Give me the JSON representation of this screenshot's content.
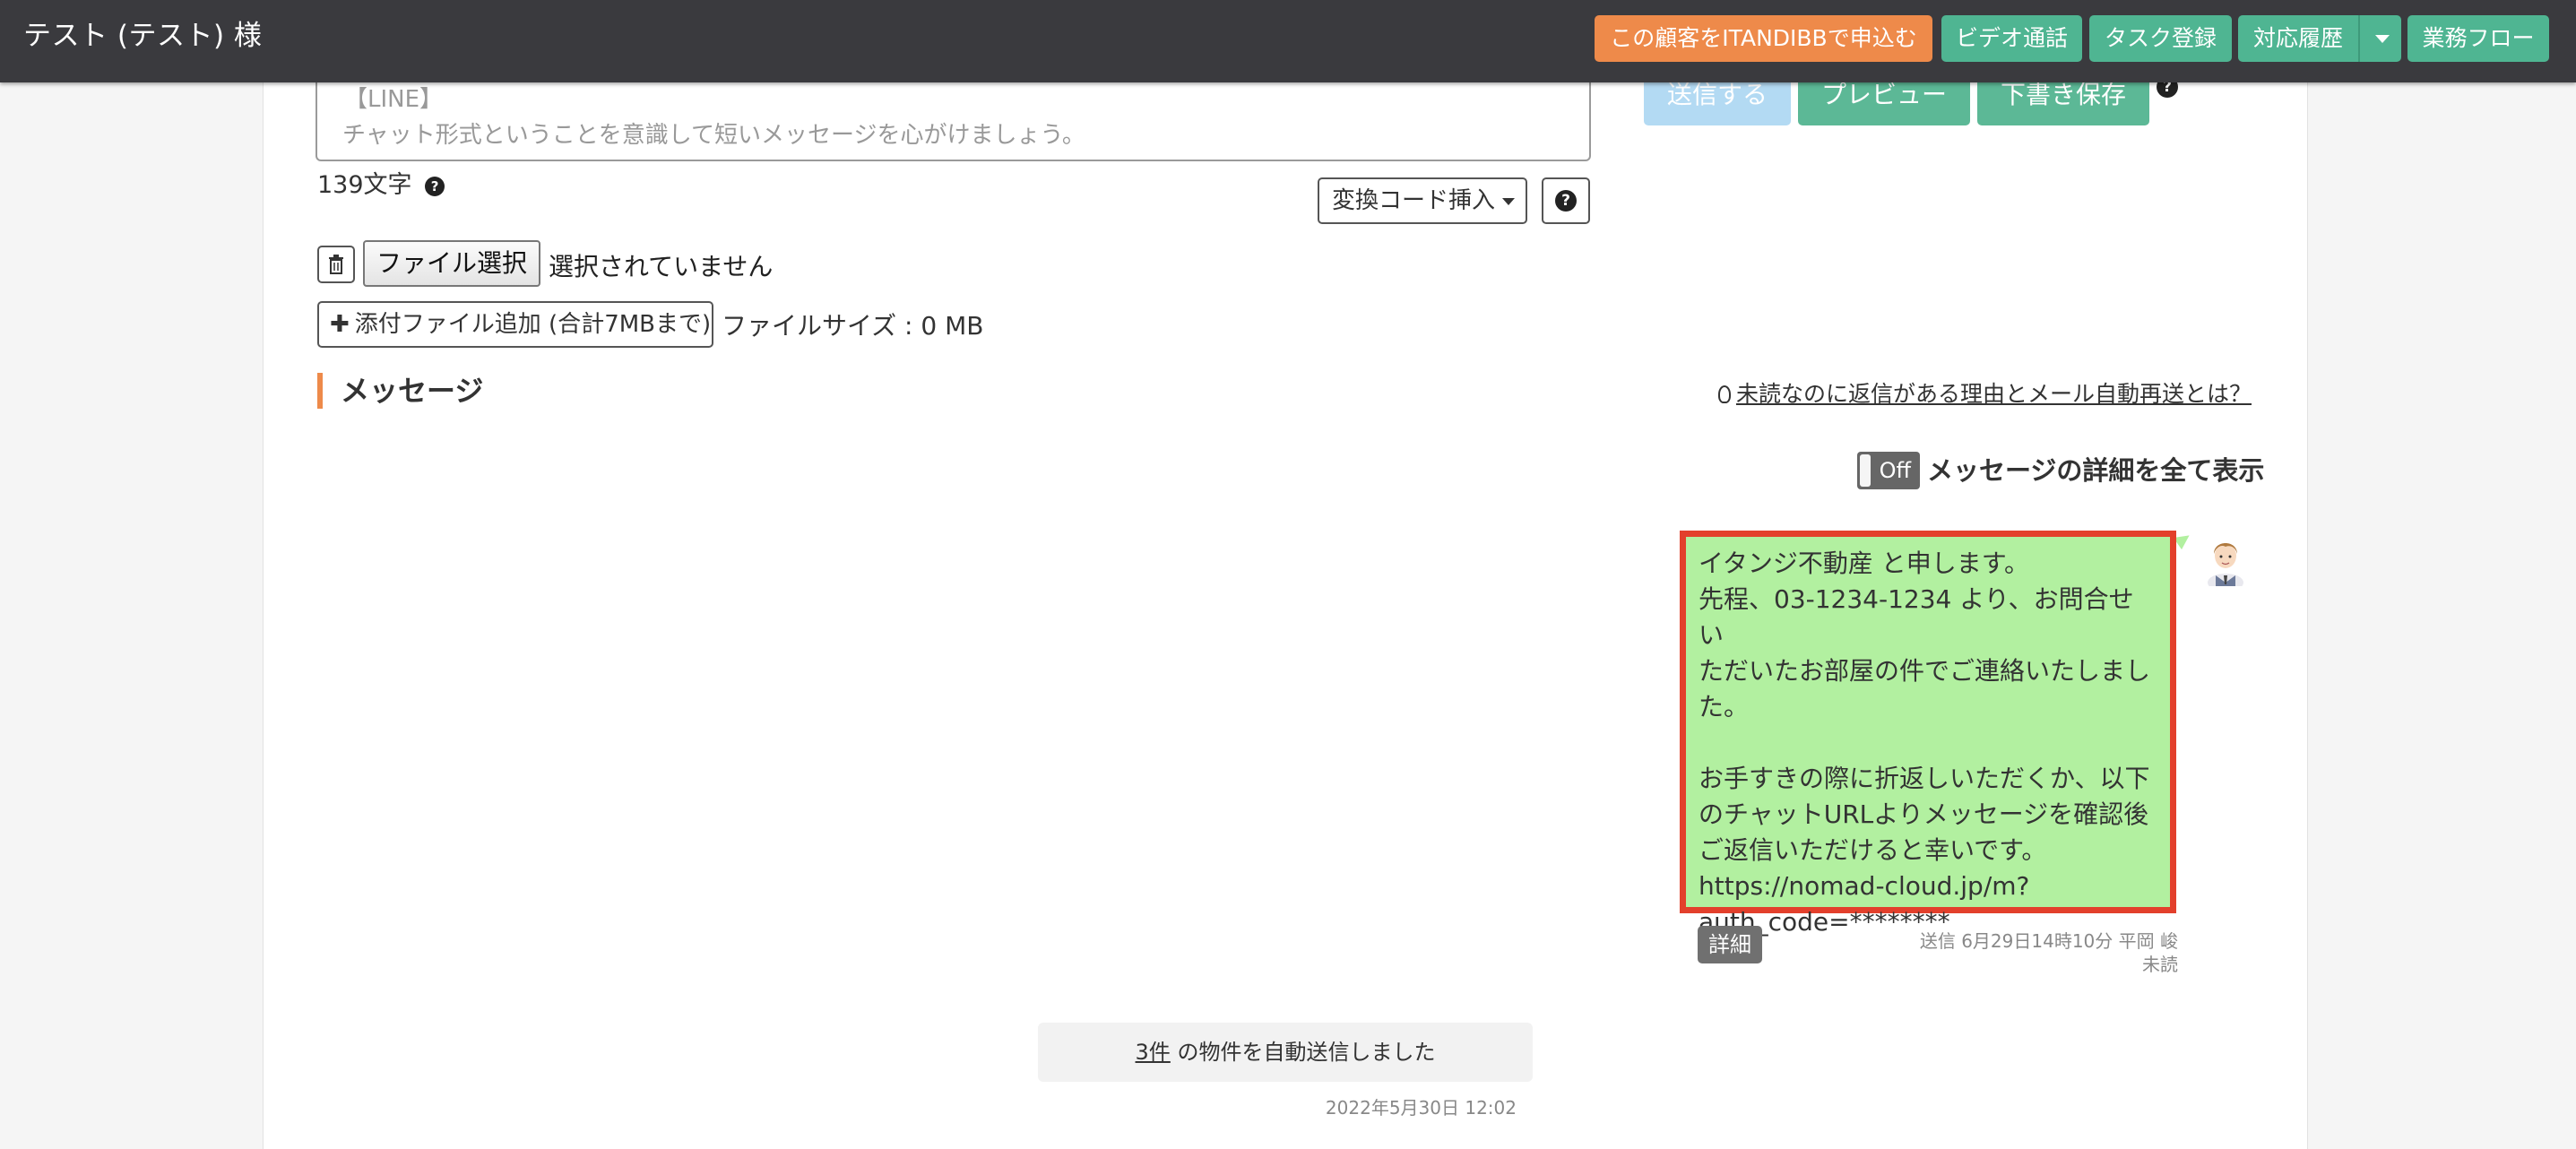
{
  "header": {
    "customer_name": "テスト (テスト) 様",
    "apply_button": "この顧客をITANDIBBで申込む",
    "video_call_button": "ビデオ通話",
    "task_button": "タスク登録",
    "history_button": "対応履歴",
    "workflow_button": "業務フロー"
  },
  "composer": {
    "channel_tag": "【LINE】",
    "placeholder": "チャット形式ということを意識して短いメッセージを心がけましょう。",
    "send_button": "送信する",
    "preview_button": "プレビュー",
    "draft_button": "下書き保存",
    "char_count": "139文字",
    "convert_code_button": "変換コード挿入",
    "file_select_button": "ファイル選択",
    "no_file_text": "選択されていません",
    "add_attachment_button": "添付ファイル追加 (合計7MBまで)",
    "file_size_text": "ファイルサイズ : 0 MB"
  },
  "messages": {
    "heading": "メッセージ",
    "help_link": "未読なのに返信がある理由とメール自動再送とは？",
    "toggle_state": "Off",
    "toggle_label": "メッセージの詳細を全て表示",
    "items": [
      {
        "lines": [
          "イタンジ不動産 と申します。",
          "先程、03-1234-1234 より、お問合せい",
          "ただいたお部屋の件でご連絡いたしまし",
          "た。",
          "",
          "お手すきの際に折返しいただくか、以下",
          "のチャットURLよりメッセージを確認後",
          "ご返信いただけると幸いです。",
          "https://nomad-cloud.jp/m?",
          "auth_code=********"
        ],
        "detail_button": "詳細",
        "sent_info": "送信 6月29日14時10分 平岡 峻",
        "read_status": "未読"
      }
    ],
    "auto_send": {
      "count_link": "3件",
      "text": "の物件を自動送信しました",
      "date": "2022年5月30日 12:02"
    }
  },
  "colors": {
    "topbar": "#3a3a3e",
    "orange": "#ee8a4a",
    "teal": "#4fb592",
    "bubble": "#b2f0a0",
    "highlight": "#e3402c"
  }
}
